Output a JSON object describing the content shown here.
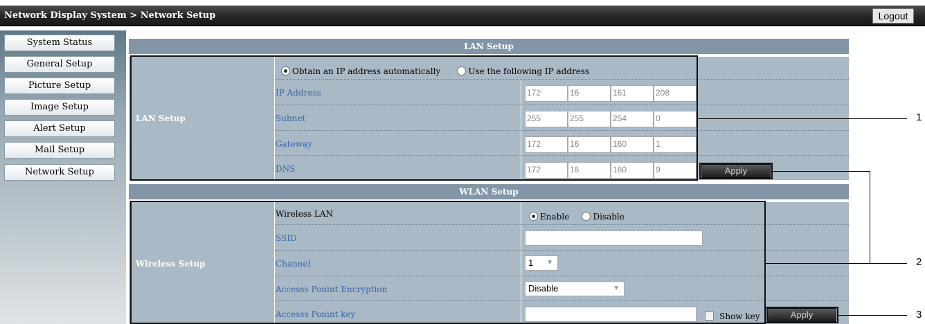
{
  "header": {
    "breadcrumb": "Network Display System > Network Setup",
    "logout": "Logout"
  },
  "sidebar": {
    "items": [
      {
        "label": "System Status"
      },
      {
        "label": "General Setup"
      },
      {
        "label": "Picture Setup"
      },
      {
        "label": "Image Setup"
      },
      {
        "label": "Alert Setup"
      },
      {
        "label": "Mail Setup"
      },
      {
        "label": "Network Setup"
      }
    ]
  },
  "lan": {
    "section_title": "LAN Setup",
    "group_label": "LAN Setup",
    "radio_auto": "Obtain an IP address automatically",
    "radio_manual": "Use the following IP address",
    "selected": "auto",
    "fields": [
      {
        "label": "IP Address",
        "octets": [
          "172",
          "16",
          "161",
          "208"
        ]
      },
      {
        "label": "Subnet",
        "octets": [
          "255",
          "255",
          "254",
          "0"
        ]
      },
      {
        "label": "Gateway",
        "octets": [
          "172",
          "16",
          "160",
          "1"
        ]
      },
      {
        "label": "DNS",
        "octets": [
          "172",
          "16",
          "160",
          "9"
        ]
      }
    ],
    "apply": "Apply"
  },
  "wlan": {
    "section_title": "WLAN Setup",
    "group_label": "Wireless Setup",
    "wireless_lan_label": "Wireless LAN",
    "enable": "Enable",
    "disable": "Disable",
    "selected": "enable",
    "ssid_label": "SSID",
    "ssid_value": "",
    "channel_label": "Channel",
    "channel_value": "1",
    "encryption_label": "Accesss Ponint Encryption",
    "encryption_value": "Disable",
    "key_label": "Accesss Ponint key",
    "key_value": "",
    "show_key": "Show key",
    "apply": "Apply"
  },
  "callouts": [
    "1",
    "2",
    "3"
  ]
}
